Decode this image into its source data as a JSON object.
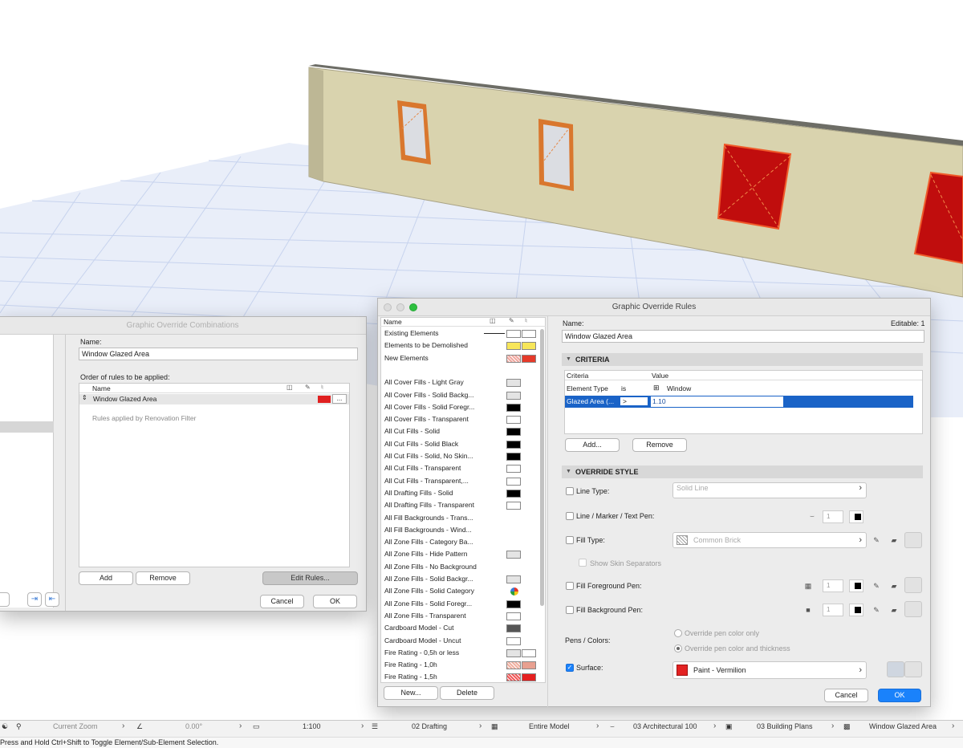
{
  "combinations_dialog": {
    "title": "Graphic Override Combinations",
    "name_label": "Name:",
    "name_value": "Window Glazed Area",
    "order_label": "Order of rules to be applied:",
    "col_name": "Name",
    "rule_row": "Window Glazed Area",
    "rule_row_color": "#e02020",
    "more_btn": "...",
    "renovation_note": "Rules applied by Renovation Filter",
    "add_btn": "Add",
    "remove_btn": "Remove",
    "edit_rules_btn": "Edit Rules...",
    "cancel_btn": "Cancel",
    "ok_btn": "OK"
  },
  "rules_dialog": {
    "title": "Graphic Override Rules",
    "list_header": "Name",
    "rules": [
      {
        "name": "Existing Elements",
        "fg": "#ffffff",
        "bg": "#ffffff",
        "line": true
      },
      {
        "name": "Elements to be Demolished",
        "fg": "#f7e65a",
        "bg": "#f7e65a"
      },
      {
        "name": "New Elements",
        "fg": "#f0a8a0",
        "bg": "#e53a2a",
        "hatch": true
      },
      {
        "name": "",
        "gap": true
      },
      {
        "name": "All Cover Fills - Light Gray",
        "fg": "#e4e4e4"
      },
      {
        "name": "All Cover Fills - Solid Backg...",
        "fg": "#e4e4e4"
      },
      {
        "name": "All Cover Fills - Solid Foregr...",
        "fg": "#000000"
      },
      {
        "name": "All Cover Fills - Transparent",
        "fg": "#ffffff"
      },
      {
        "name": "All Cut Fills - Solid",
        "fg": "#000000"
      },
      {
        "name": "All Cut Fills - Solid Black",
        "fg": "#000000"
      },
      {
        "name": "All Cut Fills - Solid, No Skin...",
        "fg": "#000000"
      },
      {
        "name": "All Cut Fills - Transparent",
        "fg": "#ffffff"
      },
      {
        "name": "All Cut Fills - Transparent,...",
        "fg": "#ffffff"
      },
      {
        "name": "All Drafting Fills - Solid",
        "fg": "#000000"
      },
      {
        "name": "All Drafting Fills - Transparent",
        "fg": "#ffffff"
      },
      {
        "name": "All Fill Backgrounds - Trans..."
      },
      {
        "name": "All Fill Backgrounds - Wind..."
      },
      {
        "name": "All Zone Fills - Category Ba..."
      },
      {
        "name": "All Zone Fills - Hide Pattern",
        "fg": "#e4e4e4"
      },
      {
        "name": "All Zone Fills - No Background"
      },
      {
        "name": "All Zone Fills - Solid Backgr...",
        "fg": "#e4e4e4"
      },
      {
        "name": "All Zone Fills - Solid Category",
        "fg": "#3a7bd5",
        "dot": true
      },
      {
        "name": "All Zone Fills - Solid Foregr...",
        "fg": "#000000"
      },
      {
        "name": "All Zone Fills - Transparent",
        "fg": "#ffffff"
      },
      {
        "name": "Cardboard Model - Cut",
        "fg": "#555555"
      },
      {
        "name": "Cardboard Model - Uncut",
        "fg": "#ffffff"
      },
      {
        "name": "Fire Rating - 0,5h or less",
        "fg": "#e4e4e4",
        "bg": "#ffffff"
      },
      {
        "name": "Fire Rating - 1,0h",
        "fg": "#f0b0a0",
        "bg": "#e8a090",
        "hatch": true
      },
      {
        "name": "Fire Rating - 1,5h",
        "fg": "#f05a5a",
        "bg": "#e52020",
        "hatch": true
      }
    ],
    "new_btn": "New...",
    "delete_btn": "Delete",
    "name_label": "Name:",
    "editable_label": "Editable: 1",
    "name_value": "Window Glazed Area",
    "criteria_header": "CRITERIA",
    "criteria_col1": "Criteria",
    "criteria_col2": "Value",
    "criteria_rows": [
      {
        "criterion": "Element Type",
        "op": "is",
        "value": "Window"
      },
      {
        "criterion": "Glazed Area (...",
        "op": ">",
        "value": "1.10"
      }
    ],
    "add_btn": "Add...",
    "remove_btn": "Remove",
    "override_header": "OVERRIDE STYLE",
    "line_type_label": "Line Type:",
    "line_type_value": "Solid Line",
    "line_pen_label": "Line / Marker / Text Pen:",
    "line_pen_value": "1",
    "fill_type_label": "Fill Type:",
    "fill_type_value": "Common Brick",
    "show_skin_label": "Show Skin Separators",
    "fill_fg_label": "Fill Foreground Pen:",
    "fill_fg_value": "1",
    "fill_bg_label": "Fill Background Pen:",
    "fill_bg_value": "1",
    "pens_colors_label": "Pens / Colors:",
    "pen_opt1": "Override pen color only",
    "pen_opt2": "Override pen color and thickness",
    "surface_label": "Surface:",
    "surface_value": "Paint - Vermilion",
    "surface_color": "#e32222",
    "cancel_btn": "Cancel",
    "ok_btn": "OK"
  },
  "status_bar": {
    "zoom": "Current Zoom",
    "angle": "0.00°",
    "scale": "1:100",
    "layer": "02 Drafting",
    "model": "Entire Model",
    "pen_set": "03 Architectural 100",
    "mvo": "03 Building Plans",
    "override": "Window Glazed Area",
    "hint": "Press and Hold Ctrl+Shift to Toggle Element/Sub-Element Selection."
  }
}
